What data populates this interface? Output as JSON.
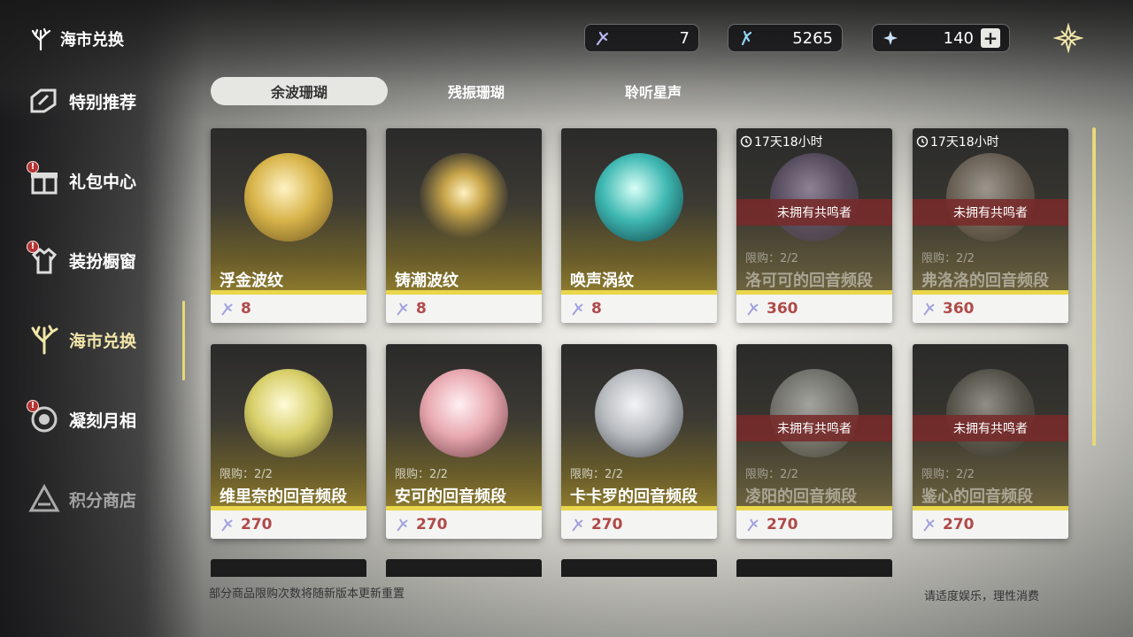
{
  "header": {
    "title": "海市兑换"
  },
  "currencies": [
    {
      "icon": "coral-icon",
      "value": "7"
    },
    {
      "icon": "afterglow-coral-icon",
      "value": "5265"
    },
    {
      "icon": "star-sound-icon",
      "value": "140",
      "plus": "+"
    }
  ],
  "sidebar": {
    "items": [
      {
        "label": "特别推荐",
        "icon": "recommend-icon",
        "badge": false,
        "state": "normal"
      },
      {
        "label": "礼包中心",
        "icon": "gift-icon",
        "badge": true,
        "state": "normal"
      },
      {
        "label": "装扮橱窗",
        "icon": "outfit-icon",
        "badge": true,
        "state": "normal"
      },
      {
        "label": "海市兑换",
        "icon": "coral-tree-icon",
        "badge": false,
        "state": "active"
      },
      {
        "label": "凝刻月相",
        "icon": "moon-icon",
        "badge": true,
        "state": "normal"
      },
      {
        "label": "积分商店",
        "icon": "triangle-icon",
        "badge": false,
        "state": "dim"
      }
    ],
    "badge_text": "!"
  },
  "tabs": [
    {
      "label": "余波珊瑚",
      "active": true
    },
    {
      "label": "残振珊瑚",
      "active": false
    },
    {
      "label": "聆听星声",
      "active": false
    }
  ],
  "cards": [
    {
      "name": "浮金波纹",
      "price": "8",
      "limit": "",
      "timer": "",
      "banner": "",
      "orb": "#d8b44a"
    },
    {
      "name": "铸潮波纹",
      "price": "8",
      "limit": "",
      "timer": "",
      "banner": "",
      "orb": "#c9a64a"
    },
    {
      "name": "唤声涡纹",
      "price": "8",
      "limit": "",
      "timer": "",
      "banner": "",
      "orb": "#3fb8b2"
    },
    {
      "name": "洛可可的回音频段",
      "price": "360",
      "limit": "限购：2/2",
      "timer": "17天18小时",
      "banner": "未拥有共鸣者",
      "orb": "#6a5a7a"
    },
    {
      "name": "弗洛洛的回音频段",
      "price": "360",
      "limit": "限购：2/2",
      "timer": "17天18小时",
      "banner": "未拥有共鸣者",
      "orb": "#8a7a6a"
    },
    {
      "name": "维里奈的回音频段",
      "price": "270",
      "limit": "限购：2/2",
      "timer": "",
      "banner": "",
      "orb": "#d8cf6a"
    },
    {
      "name": "安可的回音频段",
      "price": "270",
      "limit": "限购：2/2",
      "timer": "",
      "banner": "",
      "orb": "#e8a8b0"
    },
    {
      "name": "卡卡罗的回音频段",
      "price": "270",
      "limit": "限购：2/2",
      "timer": "",
      "banner": "",
      "orb": "#b8bcc0"
    },
    {
      "name": "凌阳的回音频段",
      "price": "270",
      "limit": "限购：2/2",
      "timer": "",
      "banner": "未拥有共鸣者",
      "orb": "#9a9a92"
    },
    {
      "name": "鉴心的回音频段",
      "price": "270",
      "limit": "限购：2/2",
      "timer": "",
      "banner": "未拥有共鸣者",
      "orb": "#6a665a"
    }
  ],
  "footer": {
    "left": "部分商品限购次数将随新版本更新重置",
    "right": "请适度娱乐，理性消费"
  }
}
